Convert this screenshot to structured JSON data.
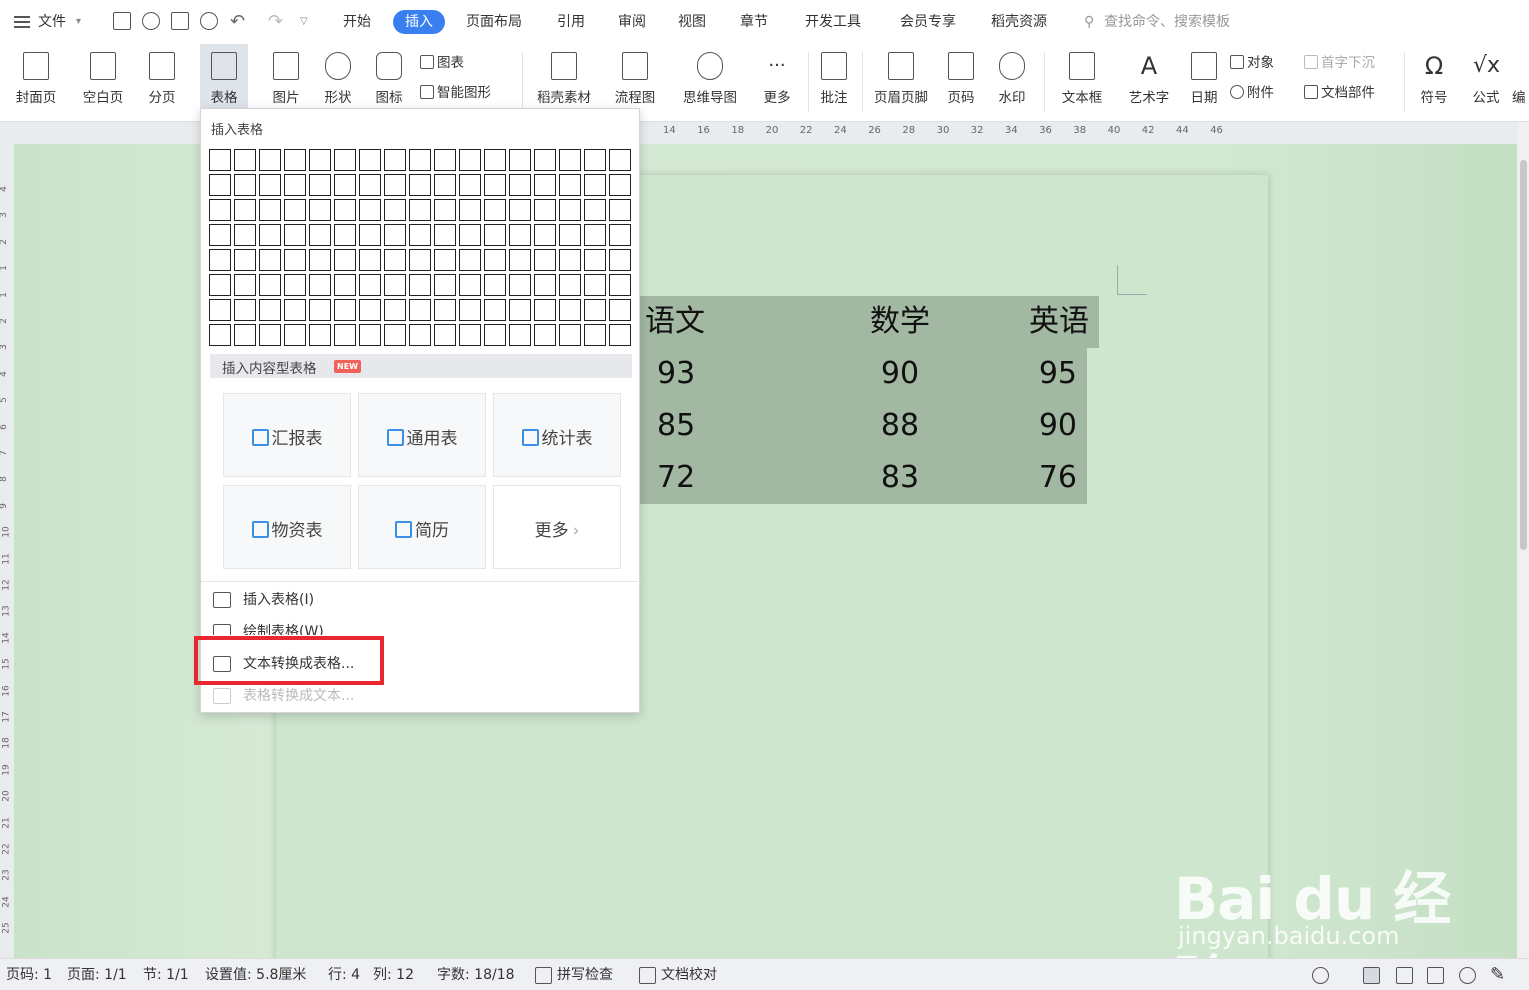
{
  "menubar": {
    "file_label": "文件",
    "tabs": [
      {
        "label": "开始"
      },
      {
        "label": "插入"
      },
      {
        "label": "页面布局"
      },
      {
        "label": "引用"
      },
      {
        "label": "审阅"
      },
      {
        "label": "视图"
      },
      {
        "label": "章节"
      },
      {
        "label": "开发工具"
      },
      {
        "label": "会员专享"
      },
      {
        "label": "稻壳资源"
      }
    ],
    "active_tab": "插入",
    "search_placeholder": "查找命令、搜索模板"
  },
  "ribbon": {
    "big_buttons": [
      {
        "label": "封面页"
      },
      {
        "label": "空白页"
      },
      {
        "label": "分页"
      },
      {
        "label": "表格"
      },
      {
        "label": "图片"
      },
      {
        "label": "形状"
      },
      {
        "label": "图标"
      },
      {
        "label": "稻壳素材"
      },
      {
        "label": "流程图"
      },
      {
        "label": "思维导图"
      },
      {
        "label": "更多"
      },
      {
        "label": "批注"
      },
      {
        "label": "页眉页脚"
      },
      {
        "label": "页码"
      },
      {
        "label": "水印"
      },
      {
        "label": "文本框"
      },
      {
        "label": "艺术字"
      },
      {
        "label": "日期"
      },
      {
        "label": "符号"
      },
      {
        "label": "公式"
      },
      {
        "label": "编"
      }
    ],
    "small_buttons": {
      "chart": "图表",
      "smart_graphic": "智能图形",
      "object": "对象",
      "dropcap": "首字下沉",
      "attachment": "附件",
      "doc_parts": "文档部件"
    }
  },
  "ruler": {
    "ticks": [
      "14",
      "16",
      "18",
      "20",
      "22",
      "24",
      "26",
      "28",
      "30",
      "32",
      "34",
      "36",
      "38",
      "40",
      "42",
      "44",
      "46"
    ],
    "vticks": [
      "4",
      "3",
      "2",
      "1",
      "1",
      "2",
      "3",
      "4",
      "5",
      "6",
      "7",
      "8",
      "9",
      "10",
      "11",
      "12",
      "13",
      "14",
      "15",
      "16",
      "17",
      "18",
      "19",
      "20",
      "21",
      "22",
      "23",
      "24",
      "25"
    ]
  },
  "table": {
    "headers": [
      "语文",
      "数学",
      "英语"
    ],
    "rows": [
      [
        "93",
        "90",
        "95"
      ],
      [
        "85",
        "88",
        "90"
      ],
      [
        "72",
        "83",
        "76"
      ]
    ]
  },
  "dropdown": {
    "title": "插入表格",
    "grid_cols": 17,
    "grid_rows": 8,
    "content_header": "插入内容型表格",
    "new_badge": "NEW",
    "cards": [
      {
        "label": "汇报表"
      },
      {
        "label": "通用表"
      },
      {
        "label": "统计表"
      },
      {
        "label": "物资表"
      },
      {
        "label": "简历"
      },
      {
        "label": "更多"
      }
    ],
    "items": [
      {
        "label": "插入表格(I)"
      },
      {
        "label": "绘制表格(W)"
      },
      {
        "label": "文本转换成表格..."
      },
      {
        "label": "表格转换成文本..."
      }
    ]
  },
  "status": {
    "page_no": "页码: 1",
    "pages": "页面: 1/1",
    "section": "节: 1/1",
    "setting": "设置值: 5.8厘米",
    "row": "行: 4",
    "col": "列: 12",
    "words": "字数: 18/18",
    "spellcheck": "拼写检查",
    "proofread": "文档校对"
  },
  "watermark": {
    "brand": "Bai du 经验",
    "url": "jingyan.baidu.com"
  },
  "colors": {
    "accent": "#3a7ff0",
    "highlight": "#e8282e",
    "page_bg": "#cde6cd",
    "table_bg": "#a3b8a3"
  }
}
